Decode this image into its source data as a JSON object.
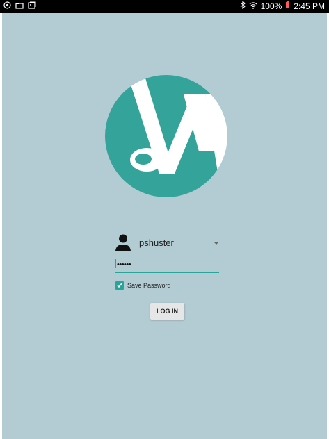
{
  "status_bar": {
    "left_icons": [
      "notification-icon",
      "folder-icon",
      "image-icon"
    ],
    "right_icons": [
      "bluetooth-icon",
      "wifi-icon",
      "battery-icon"
    ],
    "battery_percent": "100%",
    "time": "2:45 PM"
  },
  "colors": {
    "background": "#b3cbd2",
    "accent": "#26a69a",
    "logo_circle": "#34a39a"
  },
  "login": {
    "username": "pshuster",
    "password_masked": "••••••",
    "save_password_label": "Save Password",
    "save_password_checked": true,
    "login_button_label": "LOG IN"
  }
}
